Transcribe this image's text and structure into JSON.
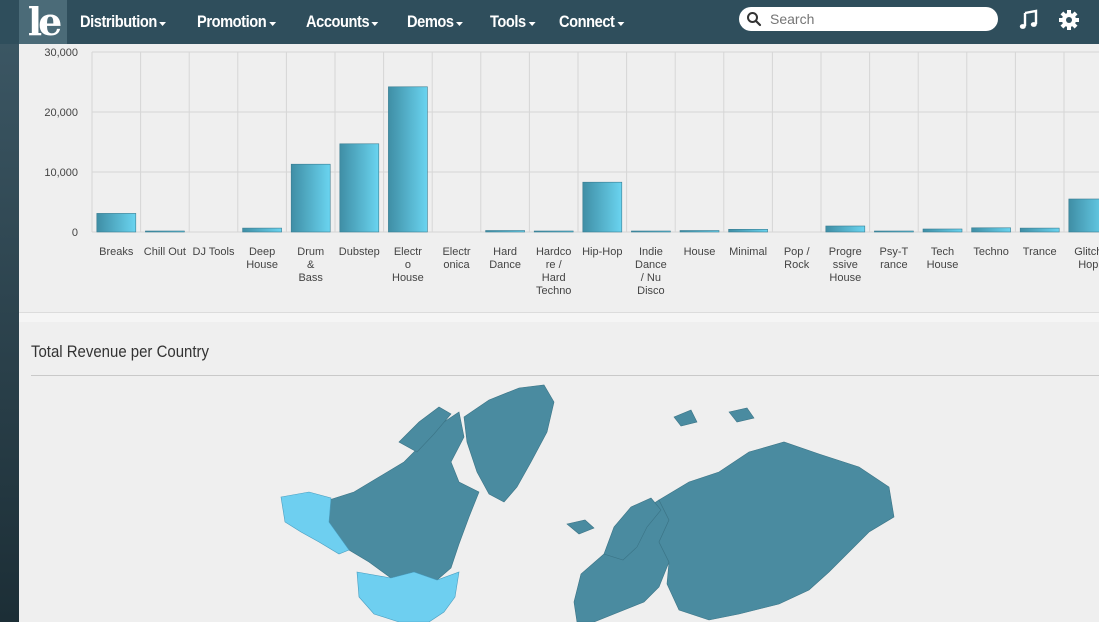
{
  "nav": {
    "logo": "le",
    "items": [
      {
        "label": "Distribution"
      },
      {
        "label": "Promotion"
      },
      {
        "label": "Accounts"
      },
      {
        "label": "Demos"
      },
      {
        "label": "Tools"
      },
      {
        "label": "Connect"
      }
    ],
    "search_placeholder": "Search",
    "icons": [
      "music-icon",
      "gear-icon"
    ]
  },
  "chart_data": {
    "type": "bar",
    "categories": [
      [
        "Breaks"
      ],
      [
        "Chill Out"
      ],
      [
        "DJ Tools"
      ],
      [
        "Deep",
        "House"
      ],
      [
        "Drum",
        "&",
        "Bass"
      ],
      [
        "Dubstep"
      ],
      [
        "Electr",
        "o",
        "House"
      ],
      [
        "Electr",
        "onica"
      ],
      [
        "Hard",
        "Dance"
      ],
      [
        "Hardco",
        "re /",
        "Hard",
        "Techno"
      ],
      [
        "Hip-Hop"
      ],
      [
        "Indie",
        "Dance",
        "/ Nu",
        "Disco"
      ],
      [
        "House"
      ],
      [
        "Minimal"
      ],
      [
        "Pop /",
        "Rock"
      ],
      [
        "Progre",
        "ssive",
        "House"
      ],
      [
        "Psy-T",
        "rance"
      ],
      [
        "Tech",
        "House"
      ],
      [
        "Techno"
      ],
      [
        "Trance"
      ],
      [
        "Glitch",
        "Hop"
      ]
    ],
    "values": [
      3100,
      150,
      0,
      650,
      11300,
      14700,
      24200,
      0,
      250,
      100,
      8300,
      100,
      250,
      450,
      0,
      1000,
      100,
      500,
      700,
      650,
      5500
    ],
    "yticks": [
      "0",
      "10,000",
      "20,000",
      "30,000"
    ],
    "ylim": [
      0,
      30000
    ],
    "bar_color_start": "#3f8ea5",
    "bar_color_end": "#6ad4f0"
  },
  "revenue_panel": {
    "title": "Total Revenue per Country",
    "map_base_color": "#4a8ba0",
    "map_highlight_color": "#6ecff0"
  }
}
